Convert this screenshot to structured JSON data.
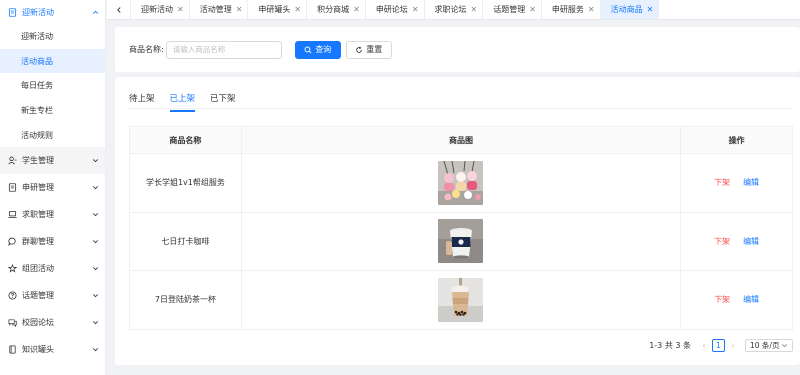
{
  "sidebar": {
    "open_group": {
      "label": "迎新活动",
      "icon": "document-icon"
    },
    "sub_items": [
      {
        "label": "迎新活动",
        "active": false
      },
      {
        "label": "活动商品",
        "active": true
      },
      {
        "label": "每日任务",
        "active": false
      },
      {
        "label": "新生专栏",
        "active": false
      },
      {
        "label": "活动规则",
        "active": false
      }
    ],
    "groups": [
      {
        "label": "学生管理",
        "icon": "user-icon",
        "highlight": true
      },
      {
        "label": "申研管理",
        "icon": "document-icon"
      },
      {
        "label": "求职管理",
        "icon": "laptop-icon"
      },
      {
        "label": "群聊管理",
        "icon": "chat-icon"
      },
      {
        "label": "组团活动",
        "icon": "group-icon"
      },
      {
        "label": "话题管理",
        "icon": "question-icon"
      },
      {
        "label": "校园论坛",
        "icon": "forum-icon"
      },
      {
        "label": "知识罐头",
        "icon": "book-icon"
      }
    ]
  },
  "tabs": [
    {
      "label": "迎新活动",
      "active": false
    },
    {
      "label": "活动管理",
      "active": false
    },
    {
      "label": "申研罐头",
      "active": false
    },
    {
      "label": "积分商城",
      "active": false
    },
    {
      "label": "申研论坛",
      "active": false
    },
    {
      "label": "求职论坛",
      "active": false
    },
    {
      "label": "话题管理",
      "active": false
    },
    {
      "label": "申研服务",
      "active": false
    },
    {
      "label": "活动商品",
      "active": true
    }
  ],
  "search": {
    "label": "商品名称:",
    "placeholder": "请输入商品名称",
    "query_label": "查询",
    "reset_label": "重置"
  },
  "inner_tabs": [
    {
      "label": "待上架",
      "active": false
    },
    {
      "label": "已上架",
      "active": true
    },
    {
      "label": "已下架",
      "active": false
    }
  ],
  "table": {
    "headers": {
      "name": "商品名称",
      "image": "商品图",
      "ops": "操作"
    },
    "rows": [
      {
        "name": "学长学姐1v1帮组服务",
        "image": "keychains-photo",
        "op_down": "下架",
        "op_edit": "编辑"
      },
      {
        "name": "七日打卡咖啡",
        "image": "coffee-cup-photo",
        "op_down": "下架",
        "op_edit": "编辑"
      },
      {
        "name": "7日登陆奶茶一杯",
        "image": "milk-tea-photo",
        "op_down": "下架",
        "op_edit": "编辑"
      }
    ]
  },
  "pager": {
    "total": "1-3 共 3 条",
    "current_page": "1",
    "page_size": "10 条/页"
  },
  "colors": {
    "primary": "#1677ff",
    "danger": "#ff4d4f"
  }
}
